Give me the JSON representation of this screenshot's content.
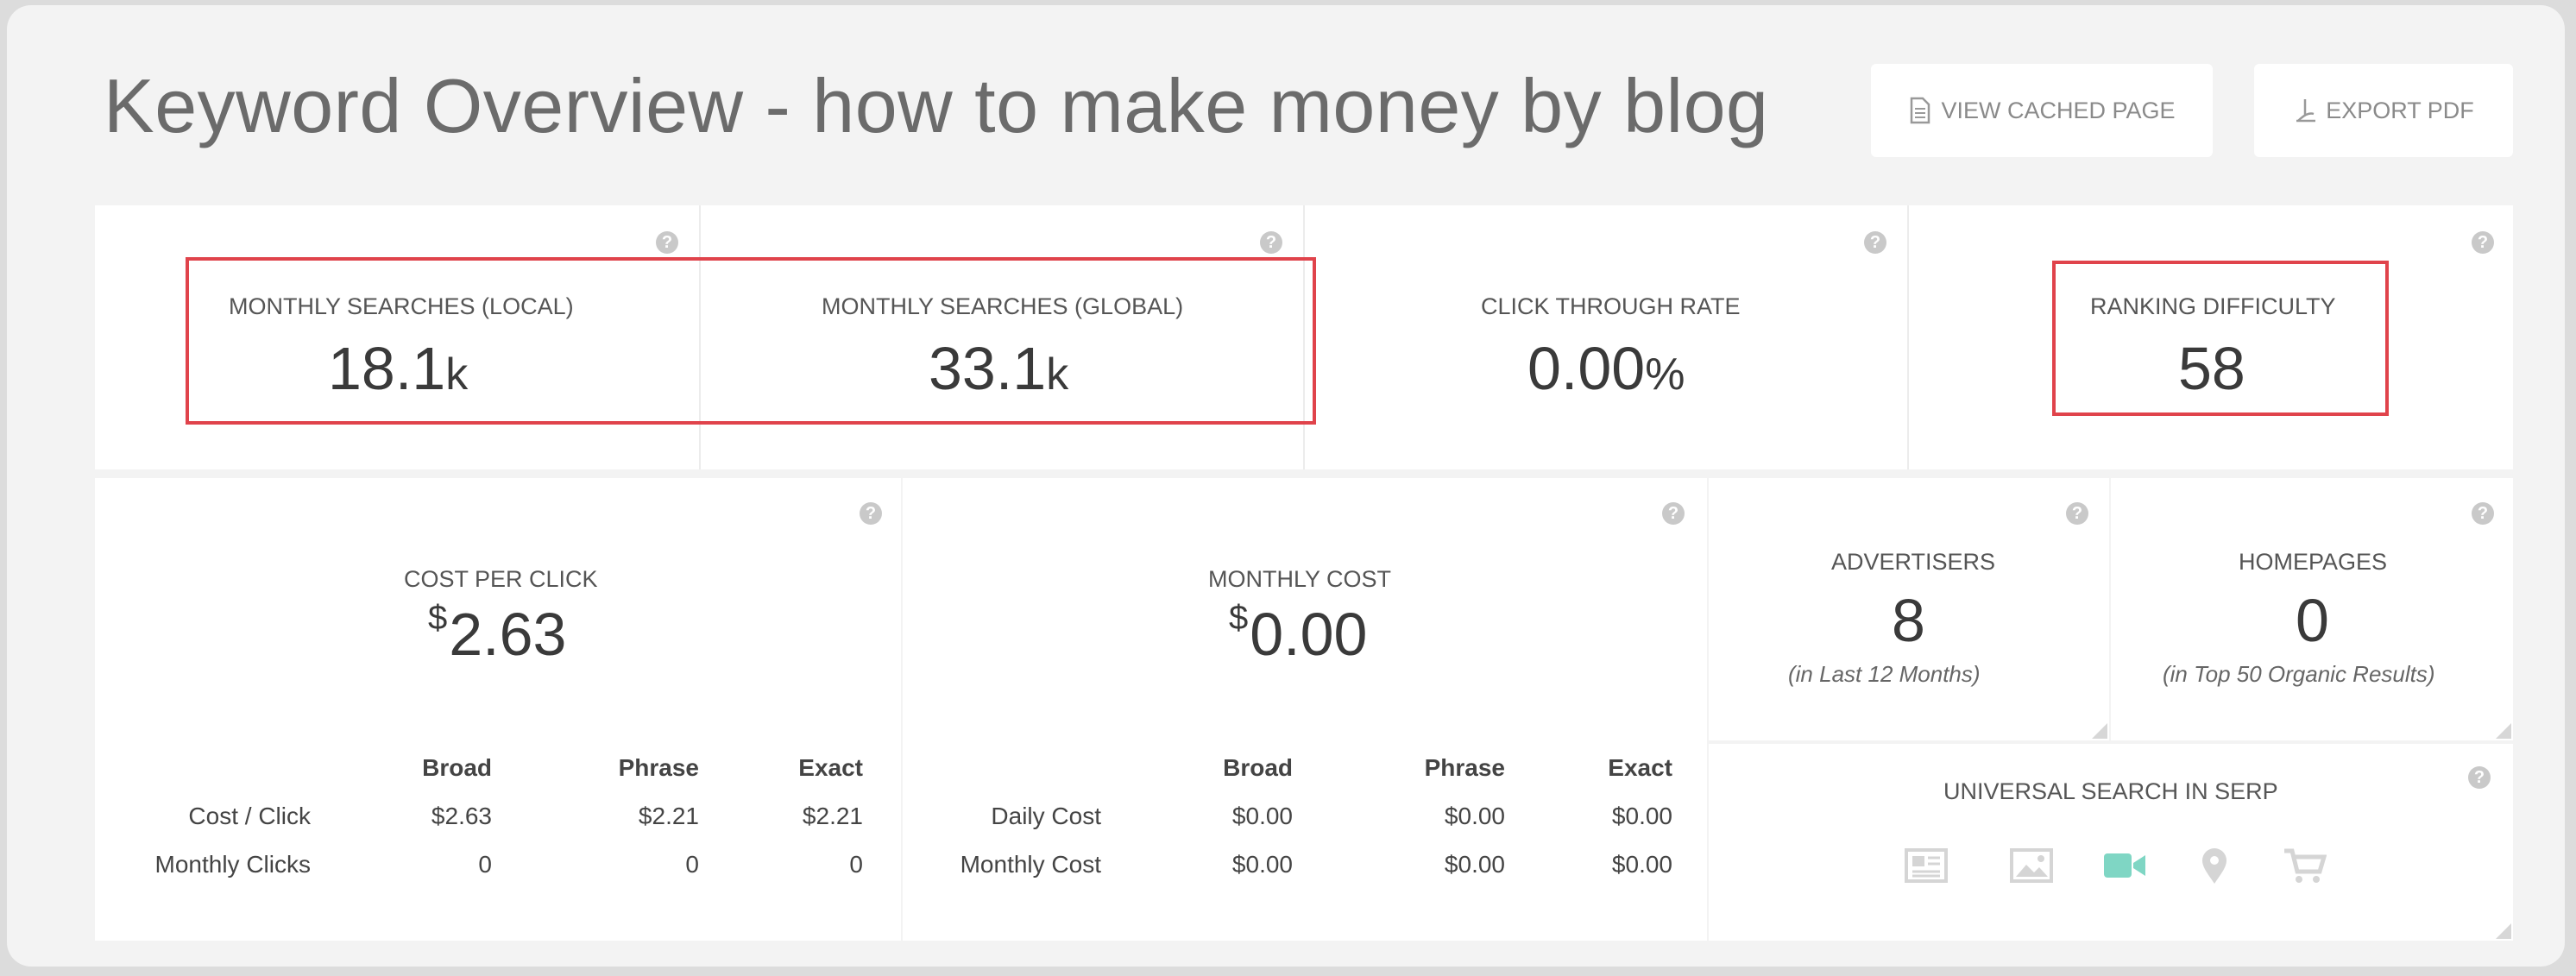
{
  "header": {
    "title": "Keyword Overview - how to make money by blog",
    "view_cached_label": "VIEW CACHED PAGE",
    "export_pdf_label": "EXPORT PDF"
  },
  "metrics": {
    "local": {
      "label": "MONTHLY SEARCHES (LOCAL)",
      "value": "18.1",
      "suffix": "k"
    },
    "global": {
      "label": "MONTHLY SEARCHES (GLOBAL)",
      "value": "33.1",
      "suffix": "k"
    },
    "ctr": {
      "label": "CLICK THROUGH RATE",
      "value": "0.00",
      "suffix": "%"
    },
    "difficulty": {
      "label": "RANKING DIFFICULTY",
      "value": "58"
    }
  },
  "cpc": {
    "label": "COST PER CLICK",
    "currency": "$",
    "value": "2.63",
    "columns": [
      "Broad",
      "Phrase",
      "Exact"
    ],
    "rows": [
      {
        "label": "Cost / Click",
        "values": [
          "$2.63",
          "$2.21",
          "$2.21"
        ]
      },
      {
        "label": "Monthly Clicks",
        "values": [
          "0",
          "0",
          "0"
        ]
      }
    ]
  },
  "monthly_cost": {
    "label": "MONTHLY COST",
    "currency": "$",
    "value": "0.00",
    "columns": [
      "Broad",
      "Phrase",
      "Exact"
    ],
    "rows": [
      {
        "label": "Daily Cost",
        "values": [
          "$0.00",
          "$0.00",
          "$0.00"
        ]
      },
      {
        "label": "Monthly Cost",
        "values": [
          "$0.00",
          "$0.00",
          "$0.00"
        ]
      }
    ]
  },
  "advertisers": {
    "label": "ADVERTISERS",
    "value": "8",
    "sub": "(in Last 12 Months)"
  },
  "homepages": {
    "label": "HOMEPAGES",
    "value": "0",
    "sub": "(in Top 50 Organic Results)"
  },
  "universal": {
    "label": "UNIVERSAL SEARCH IN SERP",
    "icons": [
      "news-icon",
      "image-icon",
      "video-icon",
      "map-pin-icon",
      "shopping-cart-icon"
    ],
    "active_icon": "video-icon"
  },
  "colors": {
    "highlight_box": "#e0434b",
    "active_icon": "#7fd6c4",
    "inactive_icon": "#d5d5d5"
  }
}
